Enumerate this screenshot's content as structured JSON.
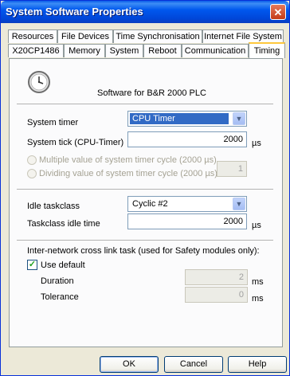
{
  "window": {
    "title": "System Software Properties",
    "close_glyph": "✕"
  },
  "tabs_row1": [
    {
      "label": "Resources"
    },
    {
      "label": "File Devices"
    },
    {
      "label": "Time Synchronisation"
    },
    {
      "label": "Internet File System"
    }
  ],
  "tabs_row2": [
    {
      "label": "X20CP1486"
    },
    {
      "label": "Memory"
    },
    {
      "label": "System"
    },
    {
      "label": "Reboot"
    },
    {
      "label": "Communication"
    },
    {
      "label": "Timing",
      "active": true
    }
  ],
  "header": {
    "icon": "clock-icon",
    "subtitle": "Software for B&R 2000 PLC"
  },
  "timer": {
    "system_timer_label": "System timer",
    "system_timer_value": "CPU Timer",
    "system_tick_label": "System tick (CPU-Timer)",
    "system_tick_value": "2000",
    "system_tick_unit": "µs",
    "multiple_label": "Multiple value of system timer cycle (2000 µs)",
    "dividing_label": "Dividing value of system timer cycle (2000 µs)",
    "dividing_value": "1"
  },
  "idle": {
    "idle_taskclass_label": "Idle taskclass",
    "idle_taskclass_value": "Cyclic #2",
    "idle_time_label": "Taskclass idle time",
    "idle_time_value": "2000",
    "idle_time_unit": "µs"
  },
  "crosslink": {
    "heading": "Inter-network cross link task (used for Safety modules only):",
    "use_default_label": "Use default",
    "use_default_checked": true,
    "duration_label": "Duration",
    "duration_value": "2",
    "duration_unit": "ms",
    "tolerance_label": "Tolerance",
    "tolerance_value": "0",
    "tolerance_unit": "ms"
  },
  "buttons": {
    "ok": "OK",
    "cancel": "Cancel",
    "help": "Help"
  },
  "colors": {
    "titlebar": "#0058ee",
    "selection": "#316ac5",
    "active_tab_accent": "#ffc83c"
  }
}
